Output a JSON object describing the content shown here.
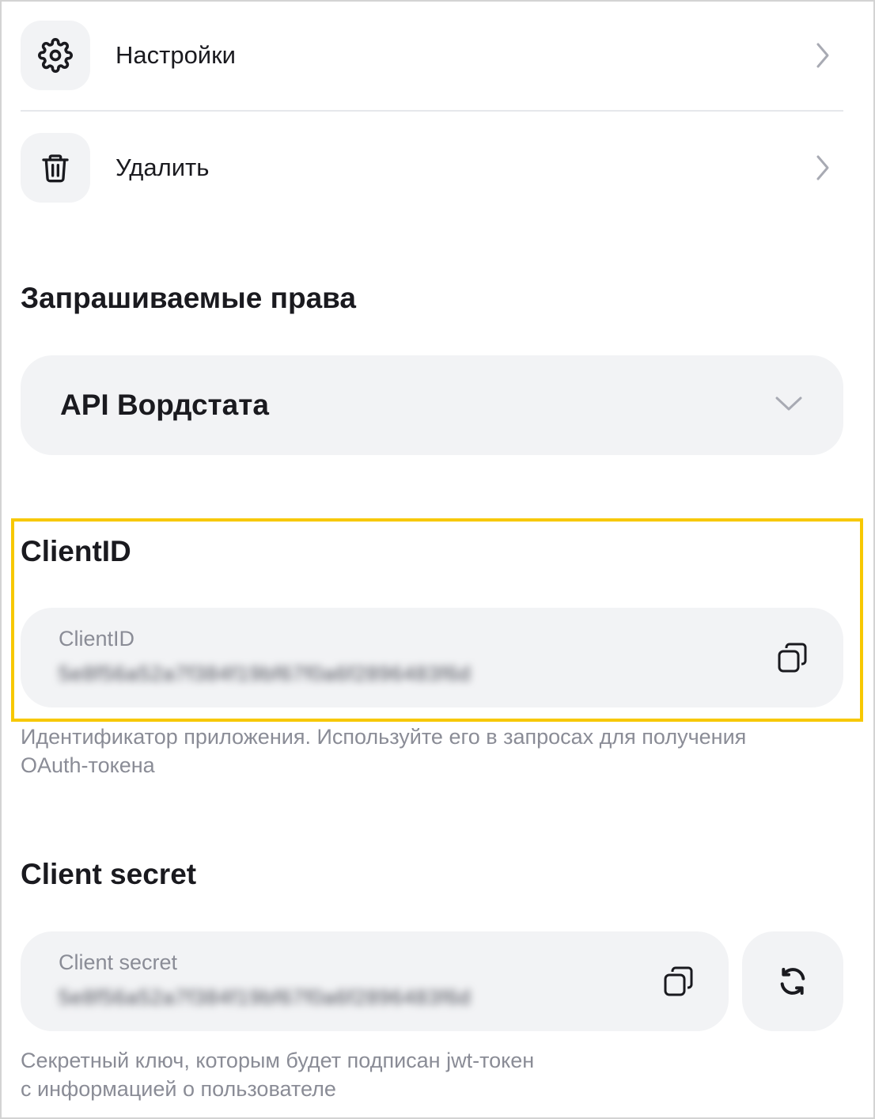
{
  "menu": {
    "settings_label": "Настройки",
    "delete_label": "Удалить"
  },
  "permissions": {
    "title": "Запрашиваемые права",
    "selected": "API Вордстата"
  },
  "client_id": {
    "title": "ClientID",
    "field_label": "ClientID",
    "value": "5e8f56a52a7f384f19bf67f0a6f2896483f6d",
    "hint": "Идентификатор приложения. Используйте его в запросах для получения OAuth-токена"
  },
  "client_secret": {
    "title": "Client secret",
    "field_label": "Client secret",
    "value": "5e8f56a52a7f384f19bf67f0a6f2896483f6d",
    "hint_line1": "Секретный ключ, которым будет подписан jwt-токен",
    "hint_line2": "с информацией о пользователе"
  },
  "colors": {
    "highlight": "#f7c800",
    "field_bg": "#f2f3f5",
    "muted_text": "#8a8c96"
  },
  "icons": [
    "gear-icon",
    "trash-icon",
    "chevron-right-icon",
    "chevron-down-icon",
    "copy-icon",
    "refresh-icon"
  ]
}
